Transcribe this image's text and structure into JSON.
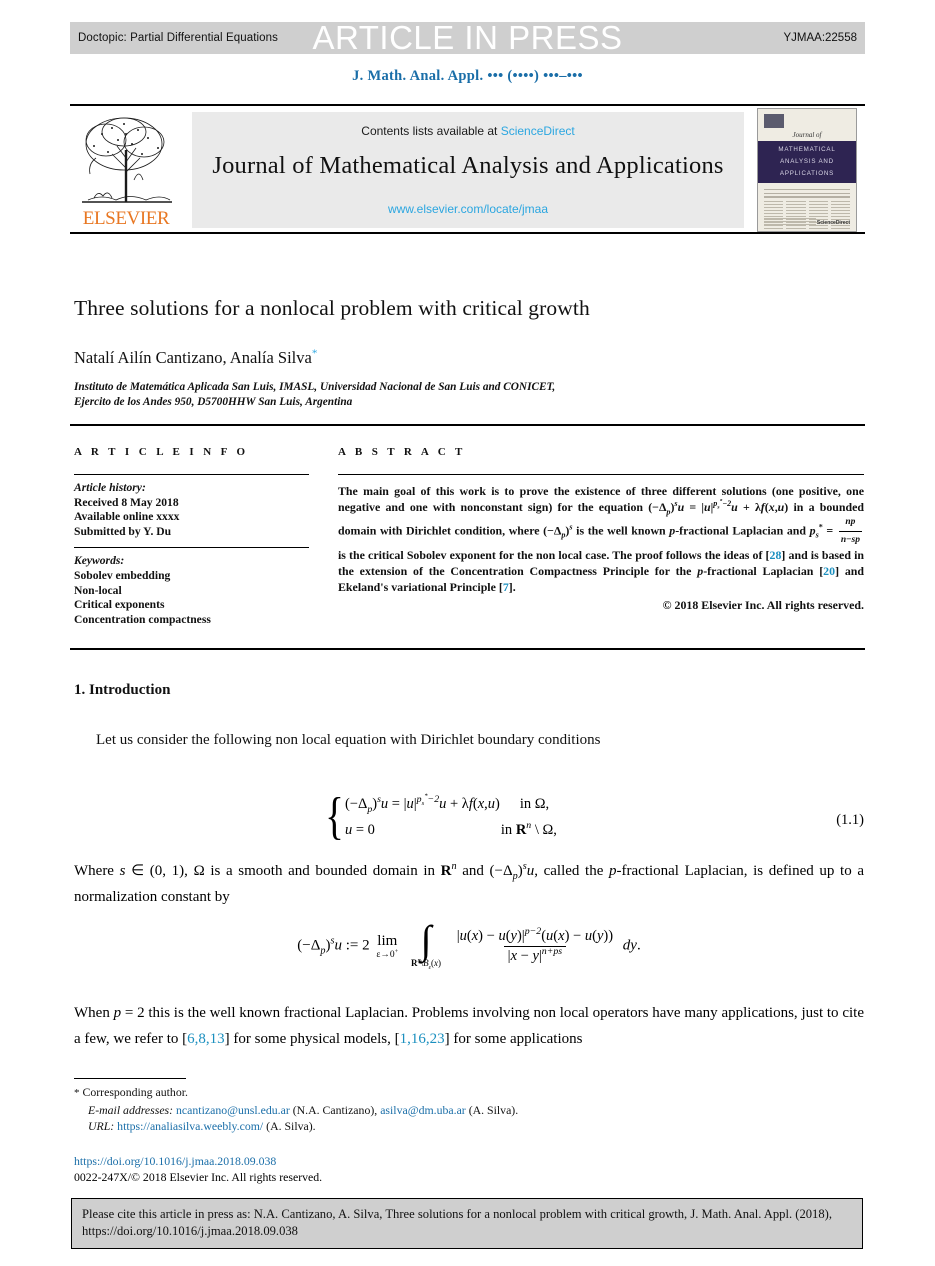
{
  "banner": {
    "doctopic": "Doctopic: Partial Differential Equations",
    "article_in_press": "ARTICLE IN PRESS",
    "article_code": "YJMAA:22558"
  },
  "journal_ref_line": "J. Math. Anal. Appl. ••• (••••) •••–•••",
  "masthead": {
    "publisher": "ELSEVIER",
    "contents_prefix": "Contents lists available at ",
    "sciencedirect": "ScienceDirect",
    "journal_title": "Journal of Mathematical Analysis and Applications",
    "journal_url": "www.elsevier.com/locate/jmaa",
    "cover": {
      "journal_of": "Journal of",
      "line1": "MATHEMATICAL",
      "line2": "ANALYSIS AND",
      "line3": "APPLICATIONS",
      "imprint": "ScienceDirect"
    }
  },
  "paper": {
    "title": "Three solutions for a nonlocal problem with critical growth",
    "authors": "Natalí Ailín Cantizano, Analía Silva",
    "author_marker": "*",
    "affiliation_line1": "Instituto de Matemática Aplicada San Luis, IMASL, Universidad Nacional de San Luis and CONICET,",
    "affiliation_line2": "Ejercito de los Andes 950, D5700HHW San Luis, Argentina"
  },
  "article_info": {
    "heading": "A R T I C L E   I N F O",
    "history_label": "Article history:",
    "received": "Received 8 May 2018",
    "available_online": "Available online xxxx",
    "submitted_by": "Submitted by Y. Du",
    "keywords_label": "Keywords:",
    "keywords": [
      "Sobolev embedding",
      "Non-local",
      "Critical exponents",
      "Concentration compactness"
    ]
  },
  "abstract": {
    "heading": "A B S T R A C T",
    "copyright": "© 2018 Elsevier Inc. All rights reserved.",
    "refs": {
      "r1": "28",
      "r2": "20",
      "r3": "7"
    }
  },
  "body": {
    "section_number_title": "1. Introduction",
    "para1": "Let us consider the following non local equation with Dirichlet boundary conditions",
    "eq1_number": "(1.1)",
    "eq1_row1_domain": "in Ω,",
    "eq1_row2_domain": "in ℝ",
    "para3_line": "When",
    "refs_physical": "6,8,13",
    "refs_applications": "1,16,23"
  },
  "footnotes": {
    "corresponding": "Corresponding author.",
    "email_label": "E-mail addresses:",
    "email1": "ncantizano@unsl.edu.ar",
    "email1_who": "(N.A. Cantizano),",
    "email2": "asilva@dm.uba.ar",
    "email2_who": "(A. Silva).",
    "url_label": "URL:",
    "url": "https://analiasilva.weebly.com/",
    "url_who": "(A. Silva).",
    "doi": "https://doi.org/10.1016/j.jmaa.2018.09.038",
    "issn_line": "0022-247X/© 2018 Elsevier Inc. All rights reserved."
  },
  "cite_box": {
    "text": "Please cite this article in press as: N.A. Cantizano, A. Silva, Three solutions for a nonlocal problem with critical growth, J. Math. Anal. Appl. (2018), https://doi.org/10.1016/j.jmaa.2018.09.038"
  },
  "colors": {
    "link_blue": "#1a6ea8",
    "sciencedirect_blue": "#2ba6e0",
    "elsevier_orange": "#E87722",
    "banner_gray": "#cfcfcf",
    "cite_ref_blue": "#1a8fbf"
  }
}
